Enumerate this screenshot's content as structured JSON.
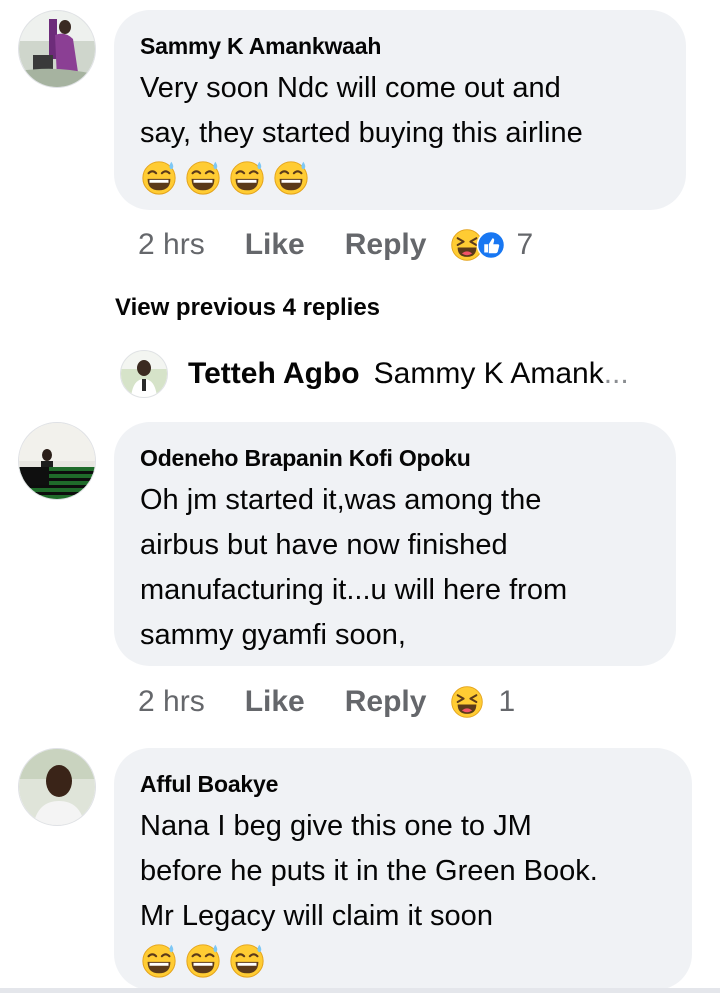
{
  "comments": [
    {
      "author": "Sammy K Amankwaah",
      "lines": [
        "Very soon Ndc will come out and",
        "say, they started buying this airline"
      ],
      "emoji_count": 4,
      "time": "2 hrs",
      "like": "Like",
      "reply": "Reply",
      "reaction_icons": [
        "haha-icon",
        "like-icon"
      ],
      "reaction_count": "7"
    },
    {
      "author": "Odeneho Brapanin Kofi Opoku",
      "lines": [
        "Oh jm started it,was among the",
        "airbus but have now finished",
        "manufacturing it...u will here from",
        "sammy gyamfi soon,"
      ],
      "time": "2 hrs",
      "like": "Like",
      "reply": "Reply",
      "reaction_icons": [
        "haha-icon"
      ],
      "reaction_count": "1"
    },
    {
      "author": "Afful Boakye",
      "lines": [
        "Nana I beg give this one to JM",
        "before he puts it in the Green Book.",
        "Mr Legacy will claim it soon"
      ],
      "emoji_count": 3
    }
  ],
  "view_previous": "View previous 4 replies",
  "reply_preview": {
    "name": "Tetteh Agbo",
    "snippet": "Sammy K Amank",
    "ellipsis": "..."
  },
  "colors": {
    "bubble": "#f0f2f5",
    "secondary_text": "#65676b",
    "like_blue": "#1877f2",
    "emoji_yellow": "#ffcc33"
  }
}
